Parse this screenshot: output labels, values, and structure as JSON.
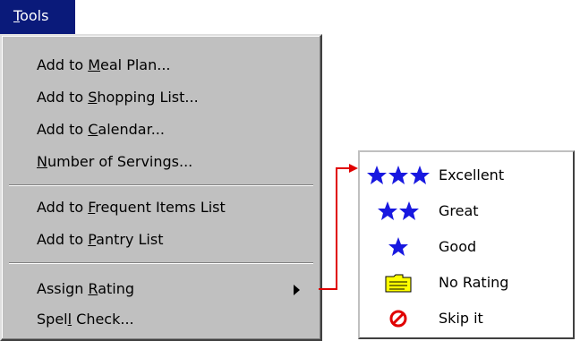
{
  "menubar": {
    "tools_label": "Tools",
    "tools_mnemonic": "T",
    "tools_rest": "ools"
  },
  "menu": {
    "items": [
      {
        "pre": "Add to ",
        "key": "M",
        "post": "eal Plan..."
      },
      {
        "pre": "Add to ",
        "key": "S",
        "post": "hopping List..."
      },
      {
        "pre": "Add to ",
        "key": "C",
        "post": "alendar..."
      },
      {
        "pre": "",
        "key": "N",
        "post": "umber of Servings..."
      },
      {
        "pre": "Add to ",
        "key": "F",
        "post": "requent Items List"
      },
      {
        "pre": "Add to ",
        "key": "P",
        "post": "antry List"
      },
      {
        "pre": "Assign ",
        "key": "R",
        "post": "ating"
      },
      {
        "pre": "Spel",
        "key": "l",
        "post": " Check..."
      }
    ]
  },
  "ratings": [
    {
      "label": "Excellent",
      "icon": "three-stars-icon"
    },
    {
      "label": "Great",
      "icon": "two-stars-icon"
    },
    {
      "label": "Good",
      "icon": "one-star-icon"
    },
    {
      "label": "No Rating",
      "icon": "folder-icon"
    },
    {
      "label": "Skip it",
      "icon": "no-entry-icon"
    }
  ],
  "colors": {
    "menubar_highlight": "#0a1a7a",
    "menu_bg": "#c0c0c0",
    "star_blue": "#1818e0",
    "connector_red": "#e00000",
    "folder_yellow": "#ffff00",
    "skip_red": "#e00000"
  }
}
